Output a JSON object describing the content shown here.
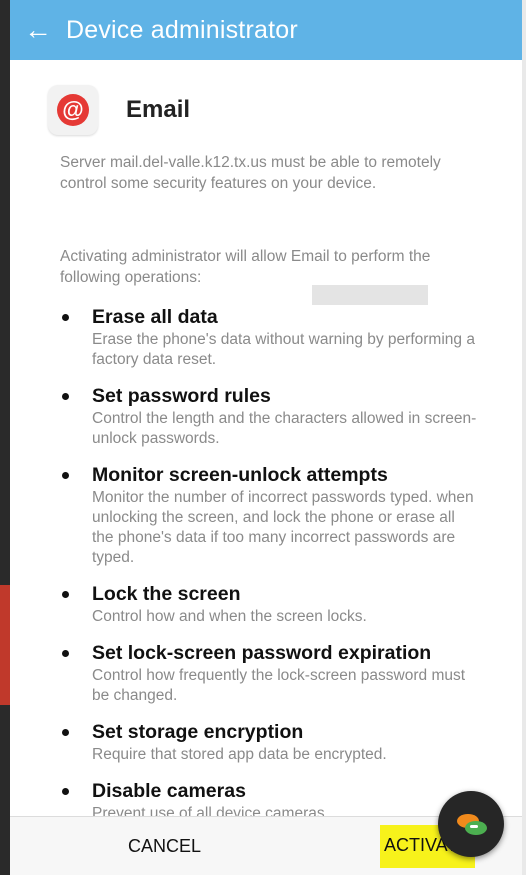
{
  "app_bar": {
    "back_glyph": "←",
    "title": "Device administrator"
  },
  "app": {
    "icon": "at-sign-icon",
    "icon_glyph": "@",
    "icon_color": "#e53935",
    "name": "Email"
  },
  "description": "Server mail.del-valle.k12.tx.us must be able to remotely control some security features on your device.",
  "intro": "Activating administrator will allow Email to perform the following operations:",
  "operations": [
    {
      "title": "Erase all data",
      "desc": "Erase the phone's data without warning by performing a factory data reset."
    },
    {
      "title": "Set password rules",
      "desc": "Control the length and the characters allowed in screen-unlock passwords."
    },
    {
      "title": "Monitor screen-unlock attempts",
      "desc": "Monitor the number of incorrect passwords typed. when unlocking the screen, and lock the phone or erase all the phone's data if too many incorrect passwords are typed."
    },
    {
      "title": "Lock the screen",
      "desc": "Control how and when the screen locks."
    },
    {
      "title": "Set lock-screen password expiration",
      "desc": "Control how frequently the lock-screen password must be changed."
    },
    {
      "title": "Set storage encryption",
      "desc": "Require that stored app data be encrypted."
    },
    {
      "title": "Disable cameras",
      "desc": "Prevent use of all device cameras."
    }
  ],
  "buttons": {
    "cancel": "CANCEL",
    "activate": "ACTIVATE"
  },
  "colors": {
    "app_bar": "#5fb3e6",
    "highlight": "#f7f21b",
    "fab": "#262626"
  }
}
